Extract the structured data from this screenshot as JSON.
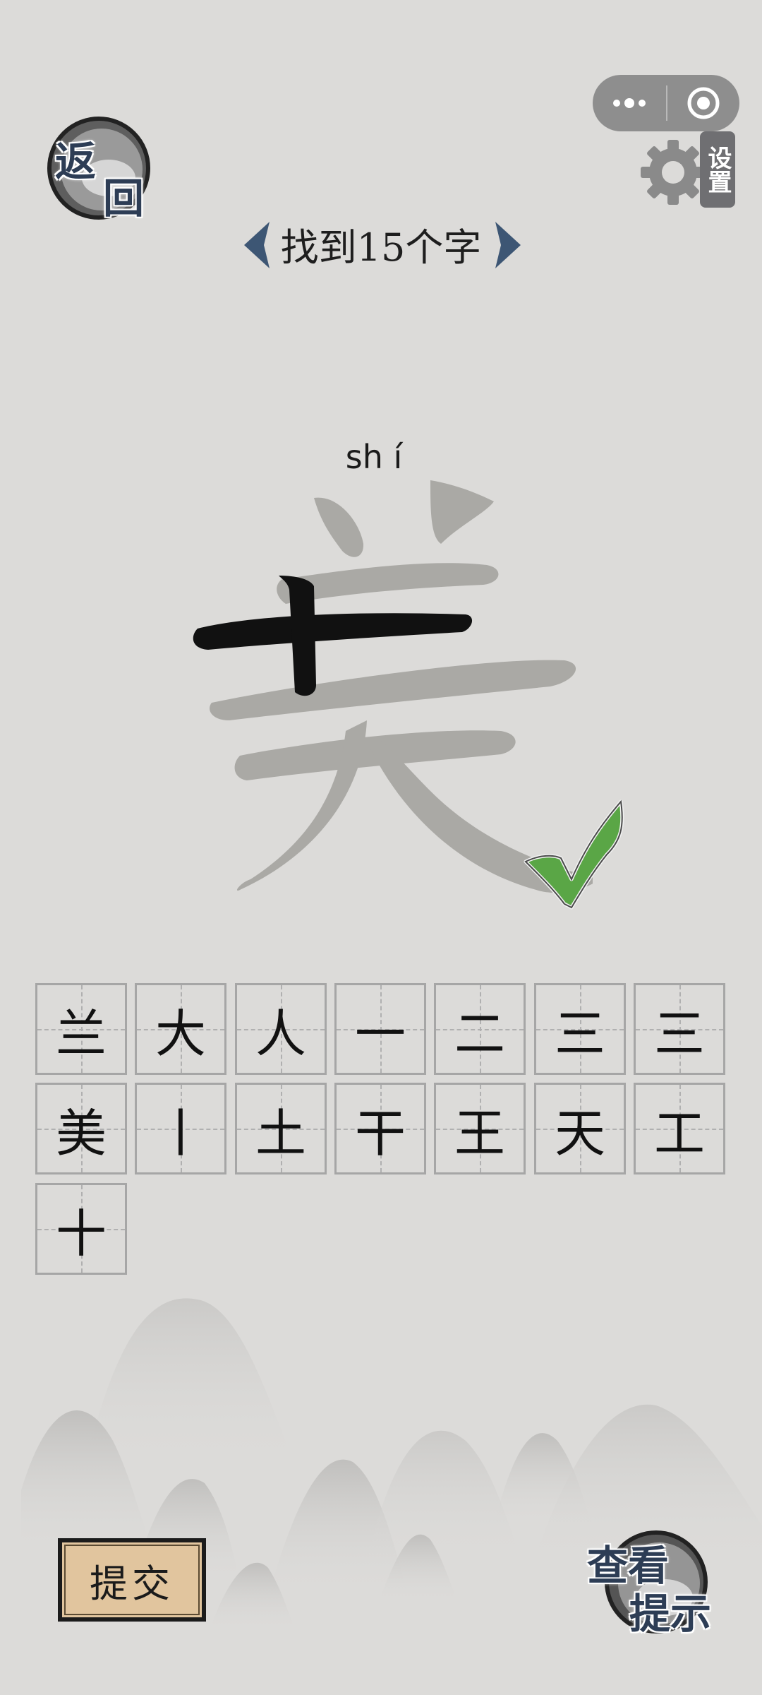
{
  "header": {
    "back_label_1": "返",
    "back_label_2": "回",
    "settings_label": "设置",
    "level_title": "找到15个字"
  },
  "target": {
    "pinyin": "sh í",
    "character": "美",
    "found_part": "十",
    "status": "correct"
  },
  "candidates": [
    "兰",
    "大",
    "人",
    "一",
    "二",
    "三",
    "三",
    "美",
    "丨",
    "土",
    "干",
    "王",
    "天",
    "工",
    "十"
  ],
  "footer": {
    "submit_label": "提交",
    "hint_label_1": "查看",
    "hint_label_2": "提示"
  },
  "colors": {
    "background": "#dcdbd9",
    "ink_blue": "#2d3d55",
    "check_green": "#5aa646",
    "submit_bg": "#e1c59e",
    "ghost_char": "#aaa9a5"
  }
}
